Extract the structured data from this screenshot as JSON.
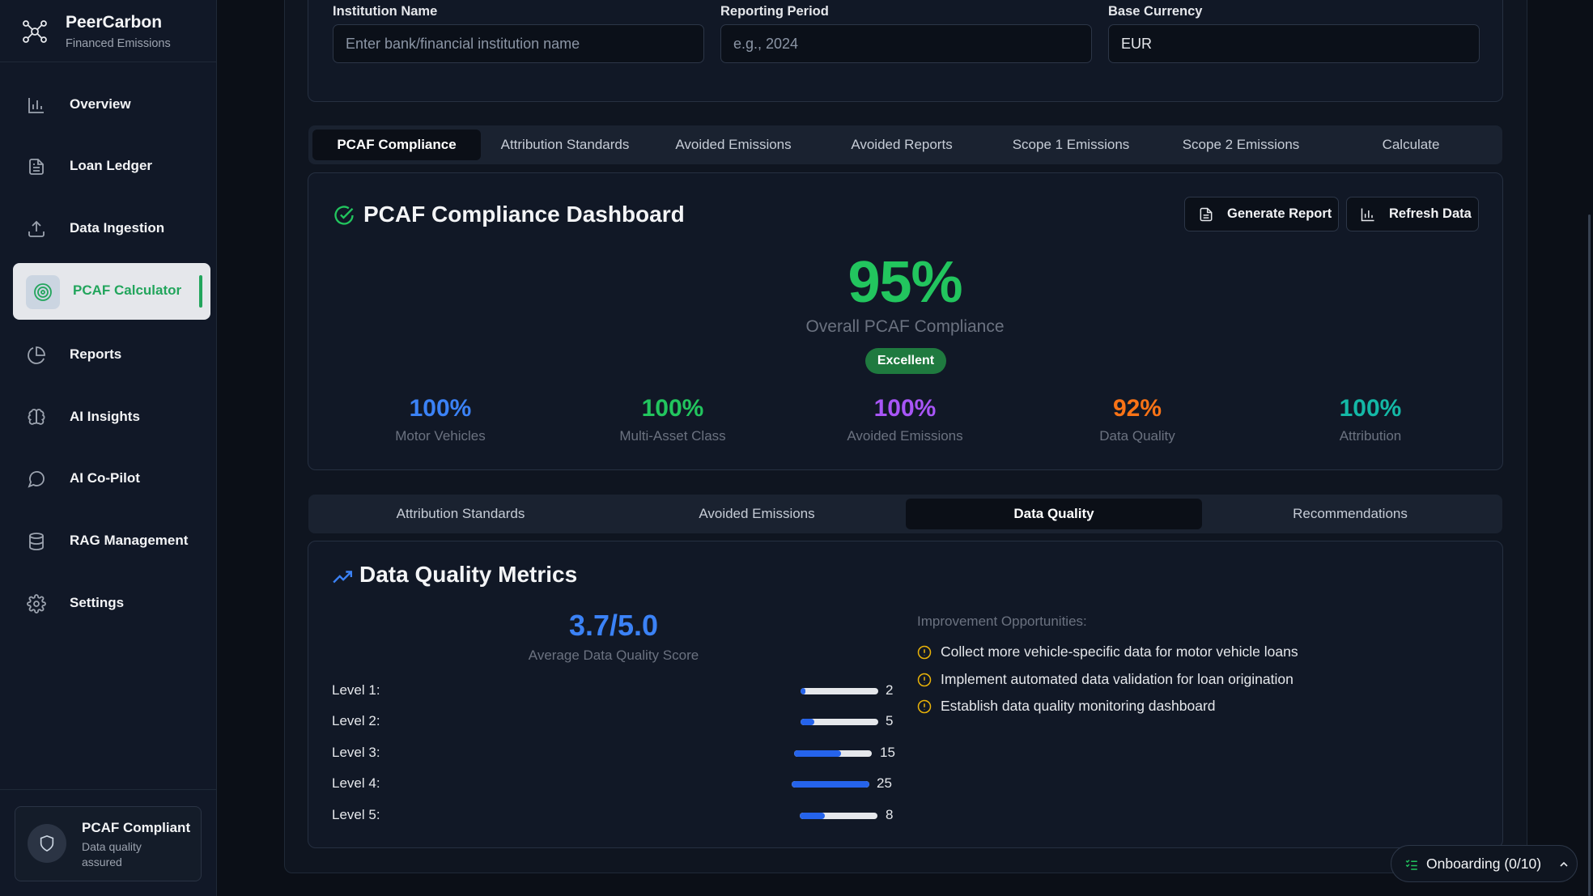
{
  "sidebar": {
    "brand_title": "PeerCarbon",
    "brand_subtitle": "Financed Emissions",
    "items": [
      {
        "label": "Overview",
        "icon": "bar-chart-icon"
      },
      {
        "label": "Loan Ledger",
        "icon": "document-icon"
      },
      {
        "label": "Data Ingestion",
        "icon": "upload-icon"
      },
      {
        "label": "PCAF Calculator",
        "icon": "target-icon",
        "active": true
      },
      {
        "label": "Reports",
        "icon": "pie-chart-icon"
      },
      {
        "label": "AI Insights",
        "icon": "brain-icon"
      },
      {
        "label": "AI Co-Pilot",
        "icon": "chat-bubble-icon"
      },
      {
        "label": "RAG Management",
        "icon": "database-icon"
      },
      {
        "label": "Settings",
        "icon": "gear-icon"
      }
    ],
    "footer": {
      "title": "PCAF Compliant",
      "subtitle": "Data quality assured",
      "icon": "shield-icon"
    }
  },
  "form": {
    "institution_label": "Institution Name",
    "institution_placeholder": "Enter bank/financial institution name",
    "period_label": "Reporting Period",
    "period_placeholder": "e.g., 2024",
    "currency_label": "Base Currency",
    "currency_value": "EUR"
  },
  "main_tabs": [
    "PCAF Compliance",
    "Attribution Standards",
    "Avoided Emissions",
    "Avoided Reports",
    "Scope 1 Emissions",
    "Scope 2 Emissions",
    "Calculate"
  ],
  "main_tabs_active": 0,
  "dashboard": {
    "title": "PCAF Compliance Dashboard",
    "generate_label": "Generate Report",
    "refresh_label": "Refresh Data",
    "overall_value": "95%",
    "overall_label": "Overall PCAF Compliance",
    "badge": "Excellent",
    "metrics": [
      {
        "value": "100%",
        "label": "Motor Vehicles",
        "color": "#3b82f6"
      },
      {
        "value": "100%",
        "label": "Multi-Asset Class",
        "color": "#22c55e"
      },
      {
        "value": "100%",
        "label": "Avoided Emissions",
        "color": "#a855f7"
      },
      {
        "value": "92%",
        "label": "Data Quality",
        "color": "#f97316"
      },
      {
        "value": "100%",
        "label": "Attribution",
        "color": "#14b8a6"
      }
    ]
  },
  "sub_tabs": [
    "Attribution Standards",
    "Avoided Emissions",
    "Data Quality",
    "Recommendations"
  ],
  "sub_tabs_active": 2,
  "data_quality": {
    "title": "Data Quality Metrics",
    "score": "3.7/5.0",
    "score_label": "Average Data Quality Score",
    "levels": [
      {
        "label": "Level 1:",
        "count": "2",
        "fill": 0.06
      },
      {
        "label": "Level 2:",
        "count": "5",
        "fill": 0.18
      },
      {
        "label": "Level 3:",
        "count": "15",
        "fill": 0.6
      },
      {
        "label": "Level 4:",
        "count": "25",
        "fill": 1.0
      },
      {
        "label": "Level 5:",
        "count": "8",
        "fill": 0.32
      }
    ],
    "opportunities_title": "Improvement Opportunities:",
    "opportunities": [
      "Collect more vehicle-specific data for motor vehicle loans",
      "Implement automated data validation for loan origination",
      "Establish data quality monitoring dashboard"
    ]
  },
  "onboarding": {
    "label": "Onboarding (0/10)"
  },
  "colors": {
    "accent_green": "#22c55e",
    "accent_blue": "#3b82f6",
    "warning": "#eab308"
  }
}
